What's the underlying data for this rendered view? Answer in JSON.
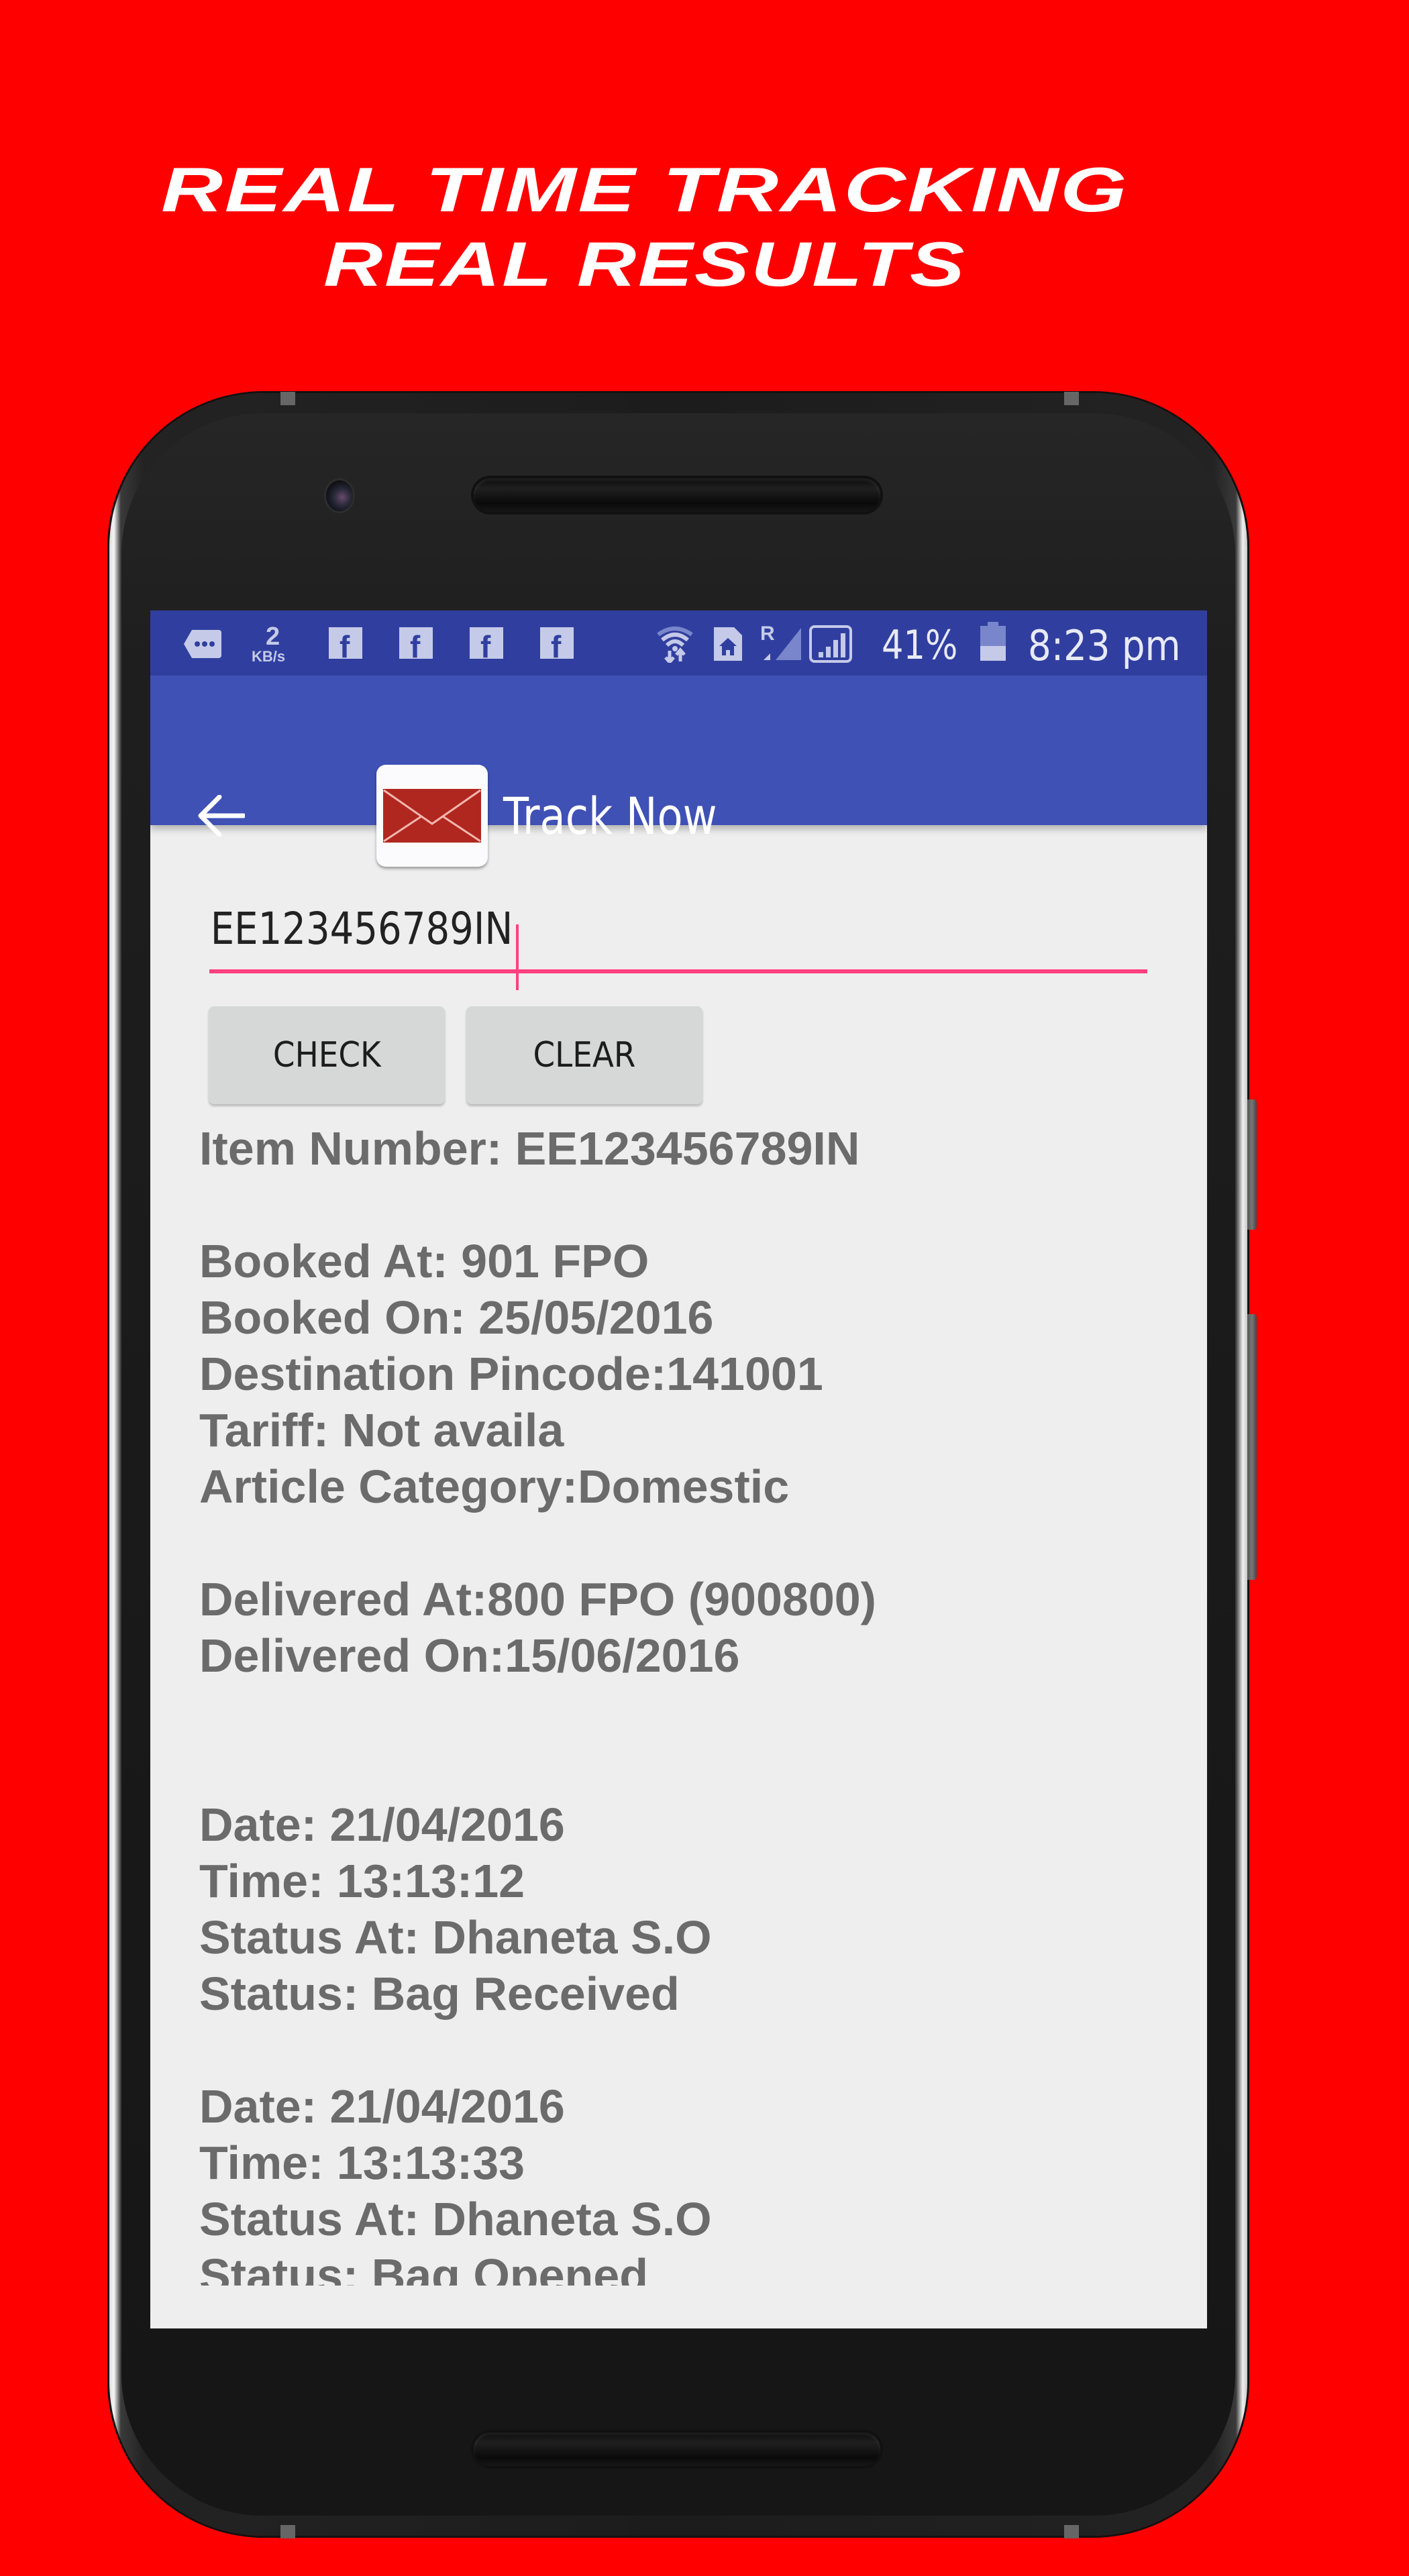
{
  "promo": {
    "headline_line1": "REAL TIME TRACKING",
    "headline_line2": "REAL RESULTS",
    "background_color": "#ff0000"
  },
  "status_bar": {
    "left_icons": [
      "message-icon",
      "facebook-icon",
      "facebook-icon",
      "facebook-icon",
      "facebook-icon"
    ],
    "network_speed_value": "2",
    "network_speed_unit": "KB/s",
    "right_icons": [
      "wifi-hotspot-icon",
      "sim-home-icon",
      "roaming-signal-icon",
      "signal-strength-icon",
      "battery-icon"
    ],
    "roaming_label": "R",
    "battery_percent_label": "41%",
    "battery_level": 0.41,
    "time": "8:23 pm",
    "color": "#303f9f"
  },
  "toolbar": {
    "back_icon": "arrow-left-icon",
    "app_icon": "envelope-icon",
    "title": "Track Now",
    "color": "#3f51b5"
  },
  "form": {
    "tracking_input_value": "EE123456789IN",
    "accent_color": "#ff4081",
    "check_label": "CHECK",
    "clear_label": "CLEAR"
  },
  "results": {
    "item_number": "Item Number: EE123456789IN",
    "booking": [
      "Booked At: 901 FPO",
      "Booked On: 25/05/2016",
      "Destination Pincode:141001",
      "Tariff: Not availa",
      "Article Category:Domestic"
    ],
    "delivery": [
      "Delivered At:800 FPO (900800)",
      "Delivered On:15/06/2016"
    ],
    "events": [
      {
        "date": "Date: 21/04/2016",
        "time": "Time: 13:13:12",
        "status_at": "Status At: Dhaneta S.O",
        "status": "Status: Bag Received"
      },
      {
        "date": "Date: 21/04/2016",
        "time": "Time: 13:13:33",
        "status_at": "Status At: Dhaneta S.O",
        "status": "Status: Bag Opened"
      }
    ]
  }
}
